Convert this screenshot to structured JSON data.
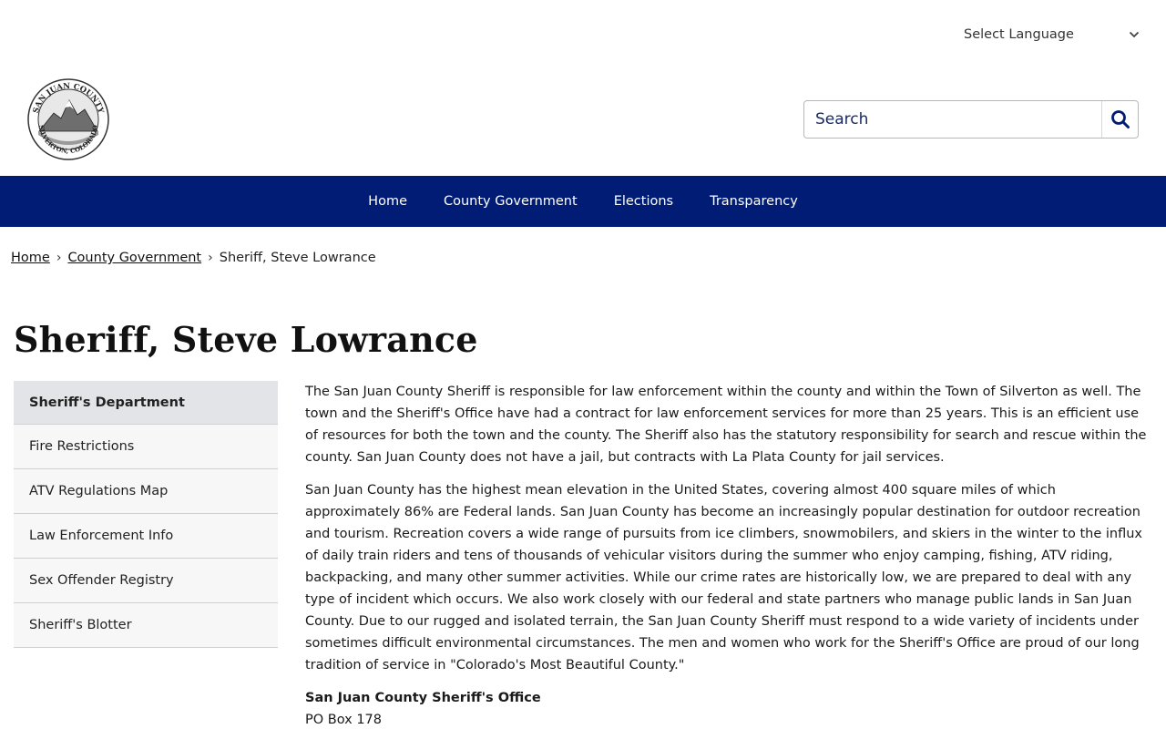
{
  "header": {
    "language_label": "Select Language",
    "search_placeholder": "Search",
    "logo": {
      "top_text": "SAN JUAN COUNTY",
      "bottom_text": "SILVERTON, COLORADO"
    }
  },
  "nav": {
    "items": [
      {
        "label": "Home"
      },
      {
        "label": "County Government"
      },
      {
        "label": "Elections"
      },
      {
        "label": "Transparency"
      }
    ]
  },
  "breadcrumb": {
    "items": [
      {
        "label": "Home"
      },
      {
        "label": "County Government"
      }
    ],
    "current": "Sheriff, Steve Lowrance"
  },
  "page": {
    "title": "Sheriff, Steve Lowrance"
  },
  "sidenav": {
    "items": [
      {
        "label": "Sheriff's Department"
      },
      {
        "label": "Fire Restrictions"
      },
      {
        "label": "ATV Regulations Map"
      },
      {
        "label": "Law Enforcement Info"
      },
      {
        "label": "Sex Offender Registry"
      },
      {
        "label": "Sheriff's Blotter"
      }
    ]
  },
  "content": {
    "paragraph_1": "The San Juan County Sheriff is responsible for law enforcement within the county and within the Town of Silverton as well. The town and the Sheriff's Office have had a contract for law enforcement services for more than 25 years. This is an efficient use of resources for both the town and the county. The Sheriff also has the statutory responsibility for search and rescue within the county. San Juan County does not have a jail, but contracts with La Plata County for jail services.",
    "paragraph_2": "San Juan County has the highest mean elevation in the United States, covering almost 400 square miles of which approximately 86% are Federal lands. San Juan County has become an increasingly popular destination for outdoor recreation and tourism. Recreation covers a wide range of pursuits from ice climbers, snowmobilers, and skiers in the winter to the influx of daily train riders and tens of thousands of vehicular visitors during the summer who enjoy camping, fishing, ATV riding, backpacking, and many other summer activities. While our crime rates are historically low, we are prepared to deal with any type of incident which occurs. We also work closely with our federal and state partners who manage public lands in San Juan County. Due to our rugged and isolated terrain, the San Juan County Sheriff must respond to a wide variety of incidents under sometimes difficult environmental circumstances. The men and women who work for the Sheriff's Office are proud of our long tradition of service in \"Colorado's Most Beautiful County.\"",
    "office_name": "San Juan County Sheriff's Office",
    "po_box": "PO Box 178"
  },
  "colors": {
    "nav_background": "#011c74",
    "search_text": "#1a2a66",
    "active_side_item": "#e2e4e8"
  },
  "icons": {
    "language_chevron": "chevron-down-icon",
    "search": "search-icon",
    "logo": "county-seal-icon"
  }
}
